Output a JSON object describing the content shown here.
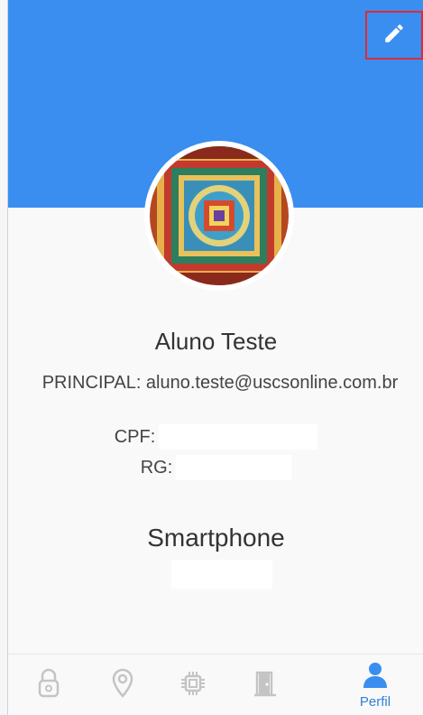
{
  "profile": {
    "name": "Aluno Teste",
    "email_line": "PRINCIPAL: aluno.teste@uscsonline.com.br",
    "cpf_label": "CPF:",
    "rg_label": "RG:"
  },
  "phone": {
    "section_title": "Smartphone"
  },
  "nav": {
    "items": [
      {
        "icon": "lock-icon",
        "label": ""
      },
      {
        "icon": "location-icon",
        "label": ""
      },
      {
        "icon": "chip-icon",
        "label": ""
      },
      {
        "icon": "door-icon",
        "label": ""
      },
      {
        "icon": "person-icon",
        "label": "Perfil"
      }
    ]
  },
  "colors": {
    "header": "#3a8ef0",
    "accent": "#2f7fd8",
    "highlight_border": "#e02b35",
    "inactive_icon": "#c4c4c4"
  }
}
